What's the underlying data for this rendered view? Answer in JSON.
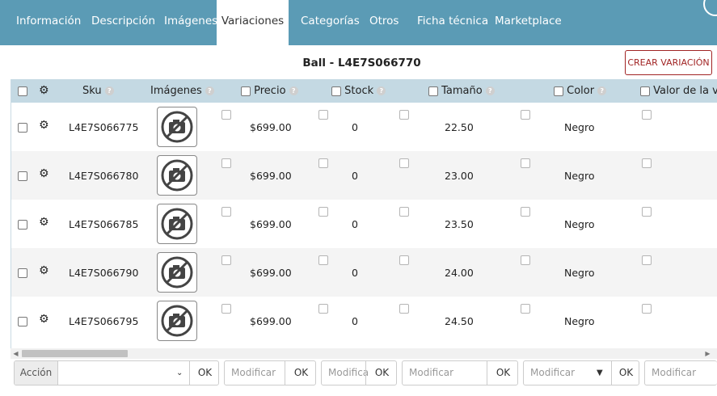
{
  "tabs": [
    "Información",
    "Descripción",
    "Imágenes",
    "Variaciones",
    "Categorías",
    "Otros",
    "Ficha técnica",
    "Marketplace"
  ],
  "active_tab": "Variaciones",
  "product_title": "Ball - L4E7S066770",
  "create_button": "CREAR VARIACIÓN",
  "columns": {
    "sku": "Sku",
    "images": "Imágenes",
    "price": "Precio",
    "stock": "Stock",
    "size": "Tamaño",
    "color": "Color",
    "value": "Valor de la var"
  },
  "help_glyph": "?",
  "rows": [
    {
      "sku": "L4E7S066775",
      "price": "$699.00",
      "stock": "0",
      "size": "22.50",
      "color": "Negro"
    },
    {
      "sku": "L4E7S066780",
      "price": "$699.00",
      "stock": "0",
      "size": "23.00",
      "color": "Negro"
    },
    {
      "sku": "L4E7S066785",
      "price": "$699.00",
      "stock": "0",
      "size": "23.50",
      "color": "Negro"
    },
    {
      "sku": "L4E7S066790",
      "price": "$699.00",
      "stock": "0",
      "size": "24.00",
      "color": "Negro"
    },
    {
      "sku": "L4E7S066795",
      "price": "$699.00",
      "stock": "0",
      "size": "24.50",
      "color": "Negro"
    }
  ],
  "bottom_bar": {
    "action_label": "Acción",
    "action_value": "",
    "ok": "OK",
    "modify_placeholder": "Modificar",
    "modify_short": "Modifica"
  },
  "icons": {
    "settings": "gear-icon",
    "no_image": "no-photo-icon",
    "scroll_left": "arrow-left-icon",
    "scroll_right": "arrow-right-icon"
  },
  "colors": {
    "tab_bar": "#5b9bb5",
    "header_row": "#c4d9e3",
    "accent_button": "#a12424"
  }
}
